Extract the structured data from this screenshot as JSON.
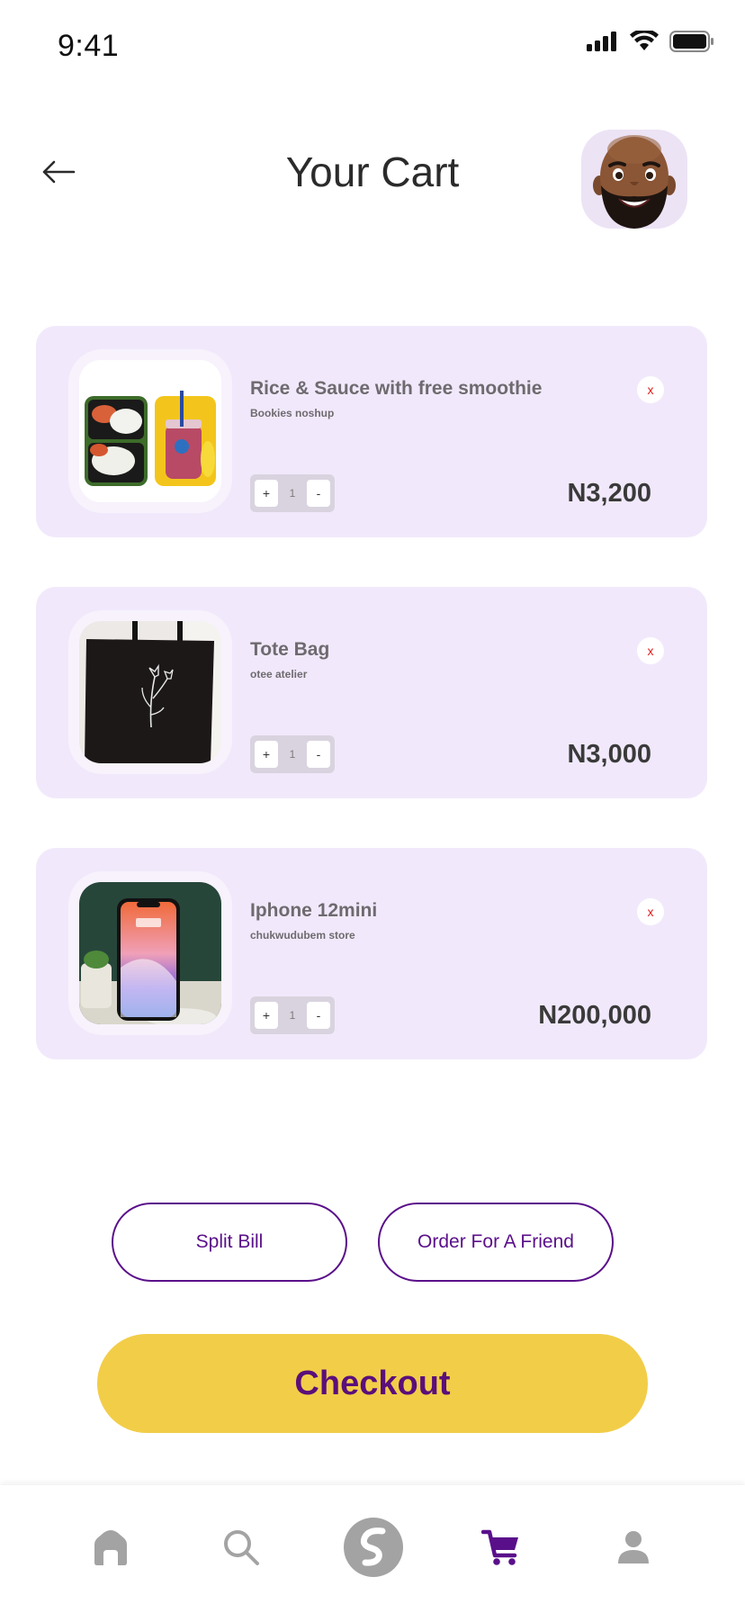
{
  "status_bar": {
    "time": "9:41",
    "icons": [
      "signal-icon",
      "wifi-icon",
      "battery-icon"
    ]
  },
  "header": {
    "title": "Your Cart",
    "back_icon": "arrow-left-icon",
    "avatar": "memoji-avatar"
  },
  "cart": {
    "items": [
      {
        "name": "Rice & Sauce with free smoothie",
        "store": "Bookies noshup",
        "quantity": "1",
        "price": "N3,200",
        "plus_label": "+",
        "minus_label": "-",
        "remove_label": "x"
      },
      {
        "name": "Tote Bag",
        "store": "otee atelier",
        "quantity": "1",
        "price": "N3,000",
        "plus_label": "+",
        "minus_label": "-",
        "remove_label": "x"
      },
      {
        "name": "Iphone 12mini",
        "store": "chukwudubem store",
        "quantity": "1",
        "price": "N200,000",
        "plus_label": "+",
        "minus_label": "-",
        "remove_label": "x"
      }
    ]
  },
  "actions": {
    "split_bill": "Split Bill",
    "order_for_friend": "Order For A Friend",
    "checkout": "Checkout"
  },
  "bottom_nav": {
    "items": [
      {
        "icon": "home-icon",
        "active": false
      },
      {
        "icon": "search-icon",
        "active": false
      },
      {
        "icon": "s-logo-icon",
        "active": false
      },
      {
        "icon": "cart-icon",
        "active": true
      },
      {
        "icon": "profile-icon",
        "active": false
      }
    ]
  },
  "colors": {
    "card_bg": "#f1e9fb",
    "accent_purple": "#5a0f8a",
    "checkout_yellow": "#f2cd48",
    "remove_red": "#e11d1d",
    "nav_inactive": "#a3a3a3"
  }
}
